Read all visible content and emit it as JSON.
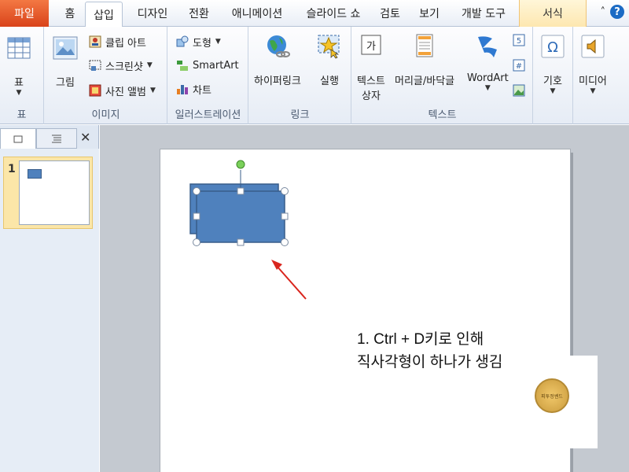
{
  "tabs": {
    "file": "파일",
    "home": "홈",
    "insert": "삽입",
    "design": "디자인",
    "transitions": "전환",
    "animations": "애니메이션",
    "slideshow": "슬라이드 쇼",
    "review": "검토",
    "view": "보기",
    "developer": "개발 도구",
    "format": "서식"
  },
  "ribbon": {
    "table_group": {
      "label": "표",
      "table_btn": "표"
    },
    "image_group": {
      "label": "이미지",
      "picture": "그림",
      "clipart": "클립 아트",
      "screenshot": "스크린샷",
      "photo_album": "사진 앨범"
    },
    "illustration_group": {
      "label": "일러스트레이션",
      "shapes": "도형",
      "smartart": "SmartArt",
      "chart": "차트"
    },
    "link_group": {
      "label": "링크",
      "hyperlink": "하이퍼링크",
      "action": "실행"
    },
    "text_group": {
      "label": "텍스트",
      "textbox_line1": "텍스트",
      "textbox_line2": "상자",
      "header_footer": "머리글/바닥글",
      "wordart": "WordArt"
    },
    "symbol_btn": "기호",
    "media_btn": "미디어"
  },
  "left_pane": {
    "slide_number": "1"
  },
  "annotation": {
    "line1": "1. Ctrl + D키로 인해",
    "line2": "직사각형이 하나가 생김"
  },
  "logo_text": "피투정쎈드",
  "colors": {
    "shape_fill": "#4f81bd",
    "shape_stroke": "#385d8a",
    "arrow": "#d9251d",
    "file_tab": "#e05a28",
    "format_tab": "#fde7b0"
  }
}
